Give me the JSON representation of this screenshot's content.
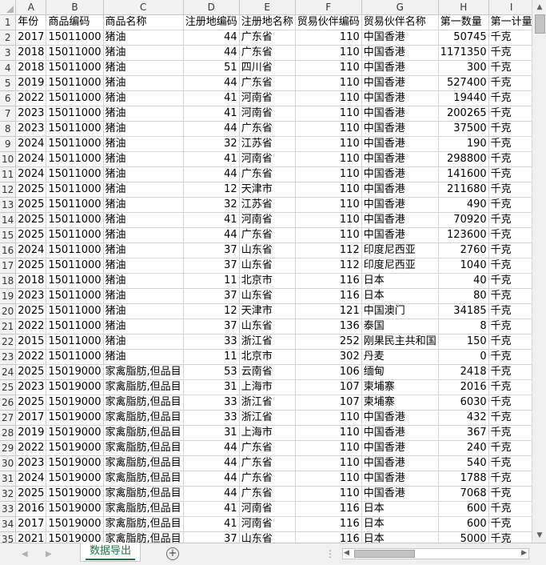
{
  "columns": [
    "A",
    "B",
    "C",
    "D",
    "E",
    "F",
    "G",
    "H",
    "I"
  ],
  "header_row": [
    "年份",
    "商品编码",
    "商品名称",
    "注册地编码",
    "注册地名称",
    "贸易伙伴编码",
    "贸易伙伴名称",
    "第一数量",
    "第一计量"
  ],
  "rows": [
    [
      "2017",
      "15011000",
      "猪油",
      "44",
      "广东省",
      "110",
      "中国香港",
      "50745",
      "千克"
    ],
    [
      "2018",
      "15011000",
      "猪油",
      "44",
      "广东省",
      "110",
      "中国香港",
      "1171350",
      "千克"
    ],
    [
      "2018",
      "15011000",
      "猪油",
      "51",
      "四川省",
      "110",
      "中国香港",
      "300",
      "千克"
    ],
    [
      "2019",
      "15011000",
      "猪油",
      "44",
      "广东省",
      "110",
      "中国香港",
      "527400",
      "千克"
    ],
    [
      "2022",
      "15011000",
      "猪油",
      "41",
      "河南省",
      "110",
      "中国香港",
      "19440",
      "千克"
    ],
    [
      "2023",
      "15011000",
      "猪油",
      "41",
      "河南省",
      "110",
      "中国香港",
      "200265",
      "千克"
    ],
    [
      "2023",
      "15011000",
      "猪油",
      "44",
      "广东省",
      "110",
      "中国香港",
      "37500",
      "千克"
    ],
    [
      "2024",
      "15011000",
      "猪油",
      "32",
      "江苏省",
      "110",
      "中国香港",
      "190",
      "千克"
    ],
    [
      "2024",
      "15011000",
      "猪油",
      "41",
      "河南省",
      "110",
      "中国香港",
      "298800",
      "千克"
    ],
    [
      "2024",
      "15011000",
      "猪油",
      "44",
      "广东省",
      "110",
      "中国香港",
      "141600",
      "千克"
    ],
    [
      "2025",
      "15011000",
      "猪油",
      "12",
      "天津市",
      "110",
      "中国香港",
      "211680",
      "千克"
    ],
    [
      "2025",
      "15011000",
      "猪油",
      "32",
      "江苏省",
      "110",
      "中国香港",
      "490",
      "千克"
    ],
    [
      "2025",
      "15011000",
      "猪油",
      "41",
      "河南省",
      "110",
      "中国香港",
      "70920",
      "千克"
    ],
    [
      "2025",
      "15011000",
      "猪油",
      "44",
      "广东省",
      "110",
      "中国香港",
      "123600",
      "千克"
    ],
    [
      "2024",
      "15011000",
      "猪油",
      "37",
      "山东省",
      "112",
      "印度尼西亚",
      "2760",
      "千克"
    ],
    [
      "2025",
      "15011000",
      "猪油",
      "37",
      "山东省",
      "112",
      "印度尼西亚",
      "1040",
      "千克"
    ],
    [
      "2018",
      "15011000",
      "猪油",
      "11",
      "北京市",
      "116",
      "日本",
      "40",
      "千克"
    ],
    [
      "2023",
      "15011000",
      "猪油",
      "37",
      "山东省",
      "116",
      "日本",
      "80",
      "千克"
    ],
    [
      "2025",
      "15011000",
      "猪油",
      "12",
      "天津市",
      "121",
      "中国澳门",
      "34185",
      "千克"
    ],
    [
      "2022",
      "15011000",
      "猪油",
      "37",
      "山东省",
      "136",
      "泰国",
      "8",
      "千克"
    ],
    [
      "2015",
      "15011000",
      "猪油",
      "33",
      "浙江省",
      "252",
      "刚果民主共和国",
      "150",
      "千克"
    ],
    [
      "2022",
      "15011000",
      "猪油",
      "11",
      "北京市",
      "302",
      "丹麦",
      "0",
      "千克"
    ],
    [
      "2025",
      "15019000",
      "家禽脂肪,但品目",
      "53",
      "云南省",
      "106",
      "缅甸",
      "2418",
      "千克"
    ],
    [
      "2023",
      "15019000",
      "家禽脂肪,但品目",
      "31",
      "上海市",
      "107",
      "柬埔寨",
      "2016",
      "千克"
    ],
    [
      "2025",
      "15019000",
      "家禽脂肪,但品目",
      "33",
      "浙江省",
      "107",
      "柬埔寨",
      "6030",
      "千克"
    ],
    [
      "2017",
      "15019000",
      "家禽脂肪,但品目",
      "33",
      "浙江省",
      "110",
      "中国香港",
      "432",
      "千克"
    ],
    [
      "2019",
      "15019000",
      "家禽脂肪,但品目",
      "31",
      "上海市",
      "110",
      "中国香港",
      "367",
      "千克"
    ],
    [
      "2022",
      "15019000",
      "家禽脂肪,但品目",
      "44",
      "广东省",
      "110",
      "中国香港",
      "240",
      "千克"
    ],
    [
      "2023",
      "15019000",
      "家禽脂肪,但品目",
      "44",
      "广东省",
      "110",
      "中国香港",
      "540",
      "千克"
    ],
    [
      "2024",
      "15019000",
      "家禽脂肪,但品目",
      "44",
      "广东省",
      "110",
      "中国香港",
      "1788",
      "千克"
    ],
    [
      "2025",
      "15019000",
      "家禽脂肪,但品目",
      "44",
      "广东省",
      "110",
      "中国香港",
      "7068",
      "千克"
    ],
    [
      "2016",
      "15019000",
      "家禽脂肪,但品目",
      "41",
      "河南省",
      "116",
      "日本",
      "600",
      "千克"
    ],
    [
      "2017",
      "15019000",
      "家禽脂肪,但品目",
      "41",
      "河南省",
      "116",
      "日本",
      "600",
      "千克"
    ],
    [
      "2021",
      "15019000",
      "家禽脂肪,但品目",
      "37",
      "山东省",
      "116",
      "日本",
      "5000",
      "千克"
    ]
  ],
  "sheet_tab": "数据导出",
  "add_sheet_symbol": "+",
  "icons": {
    "add_sheet": "plus-circle-icon",
    "nav_prev": "triangle-left-icon",
    "nav_next": "triangle-right-icon",
    "tab_split": "vertical-dots-icon",
    "scroll_up": "triangle-up-icon",
    "scroll_down": "triangle-down-icon"
  },
  "colors": {
    "active_tab": "#217346",
    "header_bg": "#f2f2f2",
    "gridline": "#d4d4d4"
  }
}
